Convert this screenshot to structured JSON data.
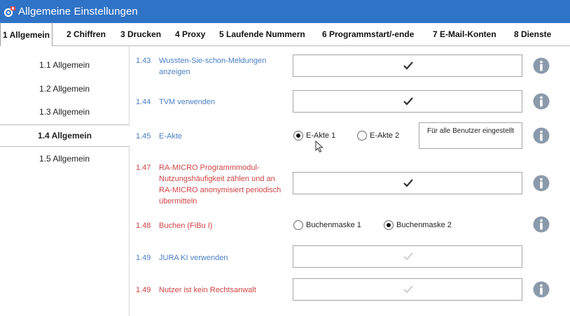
{
  "window": {
    "title": "Allgemeine Einstellungen",
    "icon": "settings-gear-icon"
  },
  "tabs": [
    {
      "label": "1 Allgemein",
      "active": true
    },
    {
      "label": "2 Chiffren"
    },
    {
      "label": "3 Drucken"
    },
    {
      "label": "4 Proxy"
    },
    {
      "label": "5 Laufende Nummern"
    },
    {
      "label": "6 Programmstart/-ende"
    },
    {
      "label": "7 E-Mail-Konten"
    },
    {
      "label": "8 Dienste"
    }
  ],
  "sidebar": {
    "items": [
      {
        "label": "1.1 Allgemein"
      },
      {
        "label": "1.2 Allgemein"
      },
      {
        "label": "1.3 Allgemein"
      },
      {
        "label": "1.4 Allgemein",
        "active": true
      },
      {
        "label": "1.5 Allgemein"
      }
    ]
  },
  "settings": [
    {
      "num": "1.43",
      "label": "Wussten-Sie-schon-Meldungen anzeigen",
      "checked": true,
      "has_info": true
    },
    {
      "num": "1.44",
      "label": "TVM verwenden",
      "checked": true,
      "has_info": true
    },
    {
      "num": "1.45",
      "label": "E-Akte",
      "options": [
        "E-Akte 1",
        "E-Akte 2"
      ],
      "selected": 0,
      "button": "Für alle Benutzer eingestellt",
      "has_info": true
    },
    {
      "num": "1.47",
      "label": "RA-MICRO Programmmodul-Nutzungshäufigkeit zählen und an RA-MICRO anonymisiert periodisch übermitteln",
      "checked": true,
      "has_info": true,
      "color": "red"
    },
    {
      "num": "1.48",
      "label": "Buchen (FiBu I)",
      "options": [
        "Buchenmaske 1",
        "Buchenmaske 2"
      ],
      "selected": 1,
      "has_info": true,
      "color": "red"
    },
    {
      "num": "1.49",
      "label": "JURA KI verwenden",
      "checked": false,
      "has_info": false
    },
    {
      "num": "1.49",
      "label": "Nutzer ist kein Rechtsanwalt",
      "checked": false,
      "has_info": true,
      "color": "red"
    }
  ],
  "colors": {
    "titlebar": "#2f73c6",
    "label_blue": "#4a7fc4",
    "label_red": "#d04444",
    "info_icon": "#8a9aab"
  }
}
